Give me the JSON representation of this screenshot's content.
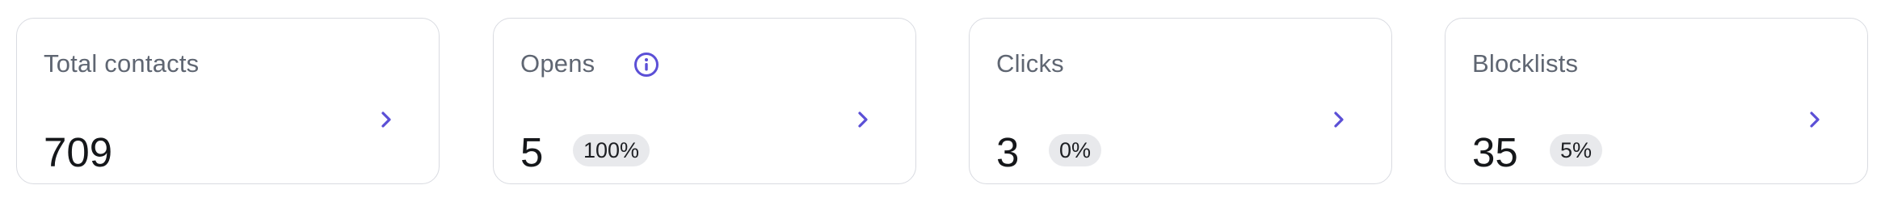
{
  "accent_color": "#5b4fd6",
  "stats": [
    {
      "title": "Total contacts",
      "value": "709",
      "badge": null,
      "has_info_icon": false,
      "arrow_icon": "chevron-right-icon"
    },
    {
      "title": "Opens",
      "value": "5",
      "badge": "100%",
      "has_info_icon": true,
      "info_icon": "info-circle-icon",
      "arrow_icon": "chevron-right-icon"
    },
    {
      "title": "Clicks",
      "value": "3",
      "badge": "0%",
      "has_info_icon": false,
      "arrow_icon": "chevron-right-icon"
    },
    {
      "title": "Blocklists",
      "value": "35",
      "badge": "5%",
      "has_info_icon": false,
      "arrow_icon": "chevron-right-icon"
    }
  ]
}
